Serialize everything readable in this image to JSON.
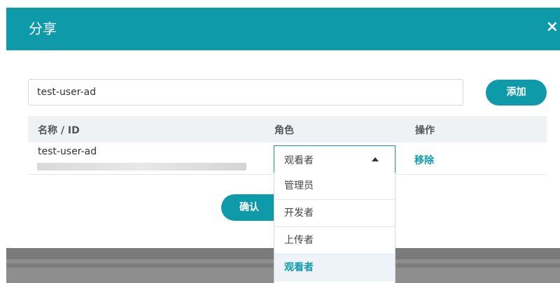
{
  "dialog": {
    "title": "分享",
    "close_symbol": "×",
    "close_icon": "close-icon"
  },
  "search": {
    "value": "test-user-ad"
  },
  "add_button": {
    "label": "添加"
  },
  "table": {
    "headers": [
      "名称 / ID",
      "角色",
      "操作"
    ],
    "rows": [
      {
        "name": "test-user-ad",
        "role": "观看者",
        "action": "移除"
      }
    ]
  },
  "role_dropdown": {
    "selected": "观看者",
    "options": [
      "管理员",
      "开发者",
      "上传者",
      "观看者"
    ],
    "active_option": "观看者",
    "caret_icon": "caret-up-icon"
  },
  "confirm_button": {
    "label": "确认"
  },
  "colors": {
    "accent": "#0f9aaa",
    "header_bg": "#0f9aaa",
    "table_header_bg": "#eef2f5"
  }
}
